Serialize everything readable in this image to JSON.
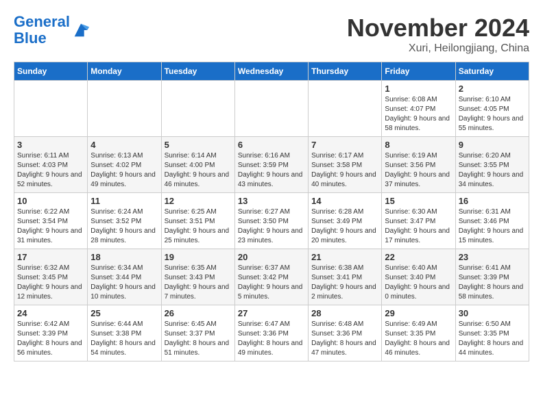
{
  "header": {
    "logo_line1": "General",
    "logo_line2": "Blue",
    "month_title": "November 2024",
    "location": "Xuri, Heilongjiang, China"
  },
  "weekdays": [
    "Sunday",
    "Monday",
    "Tuesday",
    "Wednesday",
    "Thursday",
    "Friday",
    "Saturday"
  ],
  "weeks": [
    [
      {
        "day": "",
        "info": ""
      },
      {
        "day": "",
        "info": ""
      },
      {
        "day": "",
        "info": ""
      },
      {
        "day": "",
        "info": ""
      },
      {
        "day": "",
        "info": ""
      },
      {
        "day": "1",
        "info": "Sunrise: 6:08 AM\nSunset: 4:07 PM\nDaylight: 9 hours and 58 minutes."
      },
      {
        "day": "2",
        "info": "Sunrise: 6:10 AM\nSunset: 4:05 PM\nDaylight: 9 hours and 55 minutes."
      }
    ],
    [
      {
        "day": "3",
        "info": "Sunrise: 6:11 AM\nSunset: 4:03 PM\nDaylight: 9 hours and 52 minutes."
      },
      {
        "day": "4",
        "info": "Sunrise: 6:13 AM\nSunset: 4:02 PM\nDaylight: 9 hours and 49 minutes."
      },
      {
        "day": "5",
        "info": "Sunrise: 6:14 AM\nSunset: 4:00 PM\nDaylight: 9 hours and 46 minutes."
      },
      {
        "day": "6",
        "info": "Sunrise: 6:16 AM\nSunset: 3:59 PM\nDaylight: 9 hours and 43 minutes."
      },
      {
        "day": "7",
        "info": "Sunrise: 6:17 AM\nSunset: 3:58 PM\nDaylight: 9 hours and 40 minutes."
      },
      {
        "day": "8",
        "info": "Sunrise: 6:19 AM\nSunset: 3:56 PM\nDaylight: 9 hours and 37 minutes."
      },
      {
        "day": "9",
        "info": "Sunrise: 6:20 AM\nSunset: 3:55 PM\nDaylight: 9 hours and 34 minutes."
      }
    ],
    [
      {
        "day": "10",
        "info": "Sunrise: 6:22 AM\nSunset: 3:54 PM\nDaylight: 9 hours and 31 minutes."
      },
      {
        "day": "11",
        "info": "Sunrise: 6:24 AM\nSunset: 3:52 PM\nDaylight: 9 hours and 28 minutes."
      },
      {
        "day": "12",
        "info": "Sunrise: 6:25 AM\nSunset: 3:51 PM\nDaylight: 9 hours and 25 minutes."
      },
      {
        "day": "13",
        "info": "Sunrise: 6:27 AM\nSunset: 3:50 PM\nDaylight: 9 hours and 23 minutes."
      },
      {
        "day": "14",
        "info": "Sunrise: 6:28 AM\nSunset: 3:49 PM\nDaylight: 9 hours and 20 minutes."
      },
      {
        "day": "15",
        "info": "Sunrise: 6:30 AM\nSunset: 3:47 PM\nDaylight: 9 hours and 17 minutes."
      },
      {
        "day": "16",
        "info": "Sunrise: 6:31 AM\nSunset: 3:46 PM\nDaylight: 9 hours and 15 minutes."
      }
    ],
    [
      {
        "day": "17",
        "info": "Sunrise: 6:32 AM\nSunset: 3:45 PM\nDaylight: 9 hours and 12 minutes."
      },
      {
        "day": "18",
        "info": "Sunrise: 6:34 AM\nSunset: 3:44 PM\nDaylight: 9 hours and 10 minutes."
      },
      {
        "day": "19",
        "info": "Sunrise: 6:35 AM\nSunset: 3:43 PM\nDaylight: 9 hours and 7 minutes."
      },
      {
        "day": "20",
        "info": "Sunrise: 6:37 AM\nSunset: 3:42 PM\nDaylight: 9 hours and 5 minutes."
      },
      {
        "day": "21",
        "info": "Sunrise: 6:38 AM\nSunset: 3:41 PM\nDaylight: 9 hours and 2 minutes."
      },
      {
        "day": "22",
        "info": "Sunrise: 6:40 AM\nSunset: 3:40 PM\nDaylight: 9 hours and 0 minutes."
      },
      {
        "day": "23",
        "info": "Sunrise: 6:41 AM\nSunset: 3:39 PM\nDaylight: 8 hours and 58 minutes."
      }
    ],
    [
      {
        "day": "24",
        "info": "Sunrise: 6:42 AM\nSunset: 3:39 PM\nDaylight: 8 hours and 56 minutes."
      },
      {
        "day": "25",
        "info": "Sunrise: 6:44 AM\nSunset: 3:38 PM\nDaylight: 8 hours and 54 minutes."
      },
      {
        "day": "26",
        "info": "Sunrise: 6:45 AM\nSunset: 3:37 PM\nDaylight: 8 hours and 51 minutes."
      },
      {
        "day": "27",
        "info": "Sunrise: 6:47 AM\nSunset: 3:36 PM\nDaylight: 8 hours and 49 minutes."
      },
      {
        "day": "28",
        "info": "Sunrise: 6:48 AM\nSunset: 3:36 PM\nDaylight: 8 hours and 47 minutes."
      },
      {
        "day": "29",
        "info": "Sunrise: 6:49 AM\nSunset: 3:35 PM\nDaylight: 8 hours and 46 minutes."
      },
      {
        "day": "30",
        "info": "Sunrise: 6:50 AM\nSunset: 3:35 PM\nDaylight: 8 hours and 44 minutes."
      }
    ]
  ]
}
